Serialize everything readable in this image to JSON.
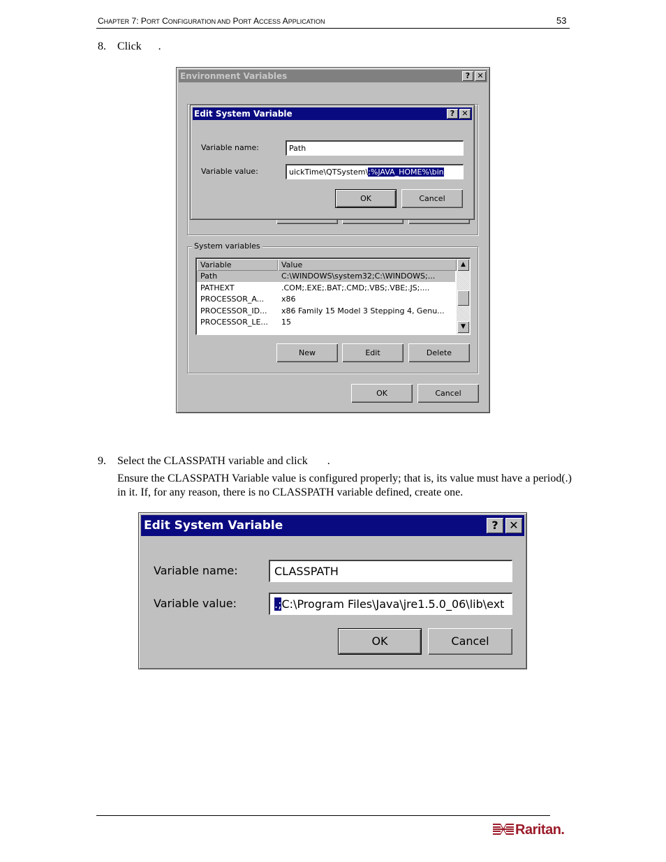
{
  "header": {
    "chapter_title_parts": [
      {
        "big": "C",
        "small": "HAPTER"
      },
      {
        "plain": " 7: "
      },
      {
        "big": "P",
        "small": "ORT"
      },
      {
        "plain": " "
      },
      {
        "big": "C",
        "small": "ONFIGURATION AND"
      },
      {
        "plain": " "
      },
      {
        "big": "P",
        "small": "ORT"
      },
      {
        "plain": " "
      },
      {
        "big": "A",
        "small": "CCESS"
      },
      {
        "plain": " "
      },
      {
        "big": "A",
        "small": "PPLICATION"
      }
    ],
    "chapter_title": "Chapter 7: Port Configuration and Port Access Application",
    "page_number": "53"
  },
  "steps": [
    {
      "number": "8.",
      "text": "Click      ."
    },
    {
      "number": "9.",
      "text": "Select the CLASSPATH variable and click       .",
      "note": "Ensure the CLASSPATH Variable value is configured properly; that is, its value must have a period(.) in it. If, for any reason, there is no CLASSPATH variable defined, create one."
    }
  ],
  "screenshot1": {
    "env_dialog": {
      "title": "Environment Variables",
      "help_button": "?",
      "close_button": "✕",
      "system_group_label": "System variables",
      "columns": [
        "Variable",
        "Value"
      ],
      "rows": [
        {
          "variable": "Path",
          "value": "C:\\WINDOWS\\system32;C:\\WINDOWS;...",
          "selected": true
        },
        {
          "variable": "PATHEXT",
          "value": ".COM;.EXE;.BAT;.CMD;.VBS;.VBE;.JS;....",
          "selected": false
        },
        {
          "variable": "PROCESSOR_A...",
          "value": "x86",
          "selected": false
        },
        {
          "variable": "PROCESSOR_ID...",
          "value": "x86 Family 15 Model 3 Stepping 4, Genu...",
          "selected": false
        },
        {
          "variable": "PROCESSOR_LE...",
          "value": "15",
          "selected": false
        }
      ],
      "new_button": "New",
      "edit_button": "Edit",
      "delete_button": "Delete",
      "ok_button": "OK",
      "cancel_button": "Cancel"
    },
    "edit_dialog": {
      "title": "Edit System Variable",
      "help_button": "?",
      "close_button": "✕",
      "name_label": "Variable name:",
      "name_value": "Path",
      "value_label": "Variable value:",
      "value_unselected": "uickTime\\QTSystem\\",
      "value_selected": ";%JAVA_HOME%\\bin",
      "ok_button": "OK",
      "cancel_button": "Cancel"
    }
  },
  "screenshot2": {
    "edit_dialog": {
      "title": "Edit System Variable",
      "help_button": "?",
      "close_button": "✕",
      "name_label": "Variable name:",
      "name_value": "CLASSPATH",
      "value_label": "Variable value:",
      "value_selected": ".;",
      "value_unselected": "C:\\Program Files\\Java\\jre1.5.0_06\\lib\\ext",
      "ok_button": "OK",
      "cancel_button": "Cancel"
    }
  },
  "footer": {
    "logo_text": "Raritan.",
    "brand_color": "#9b1b2a"
  }
}
